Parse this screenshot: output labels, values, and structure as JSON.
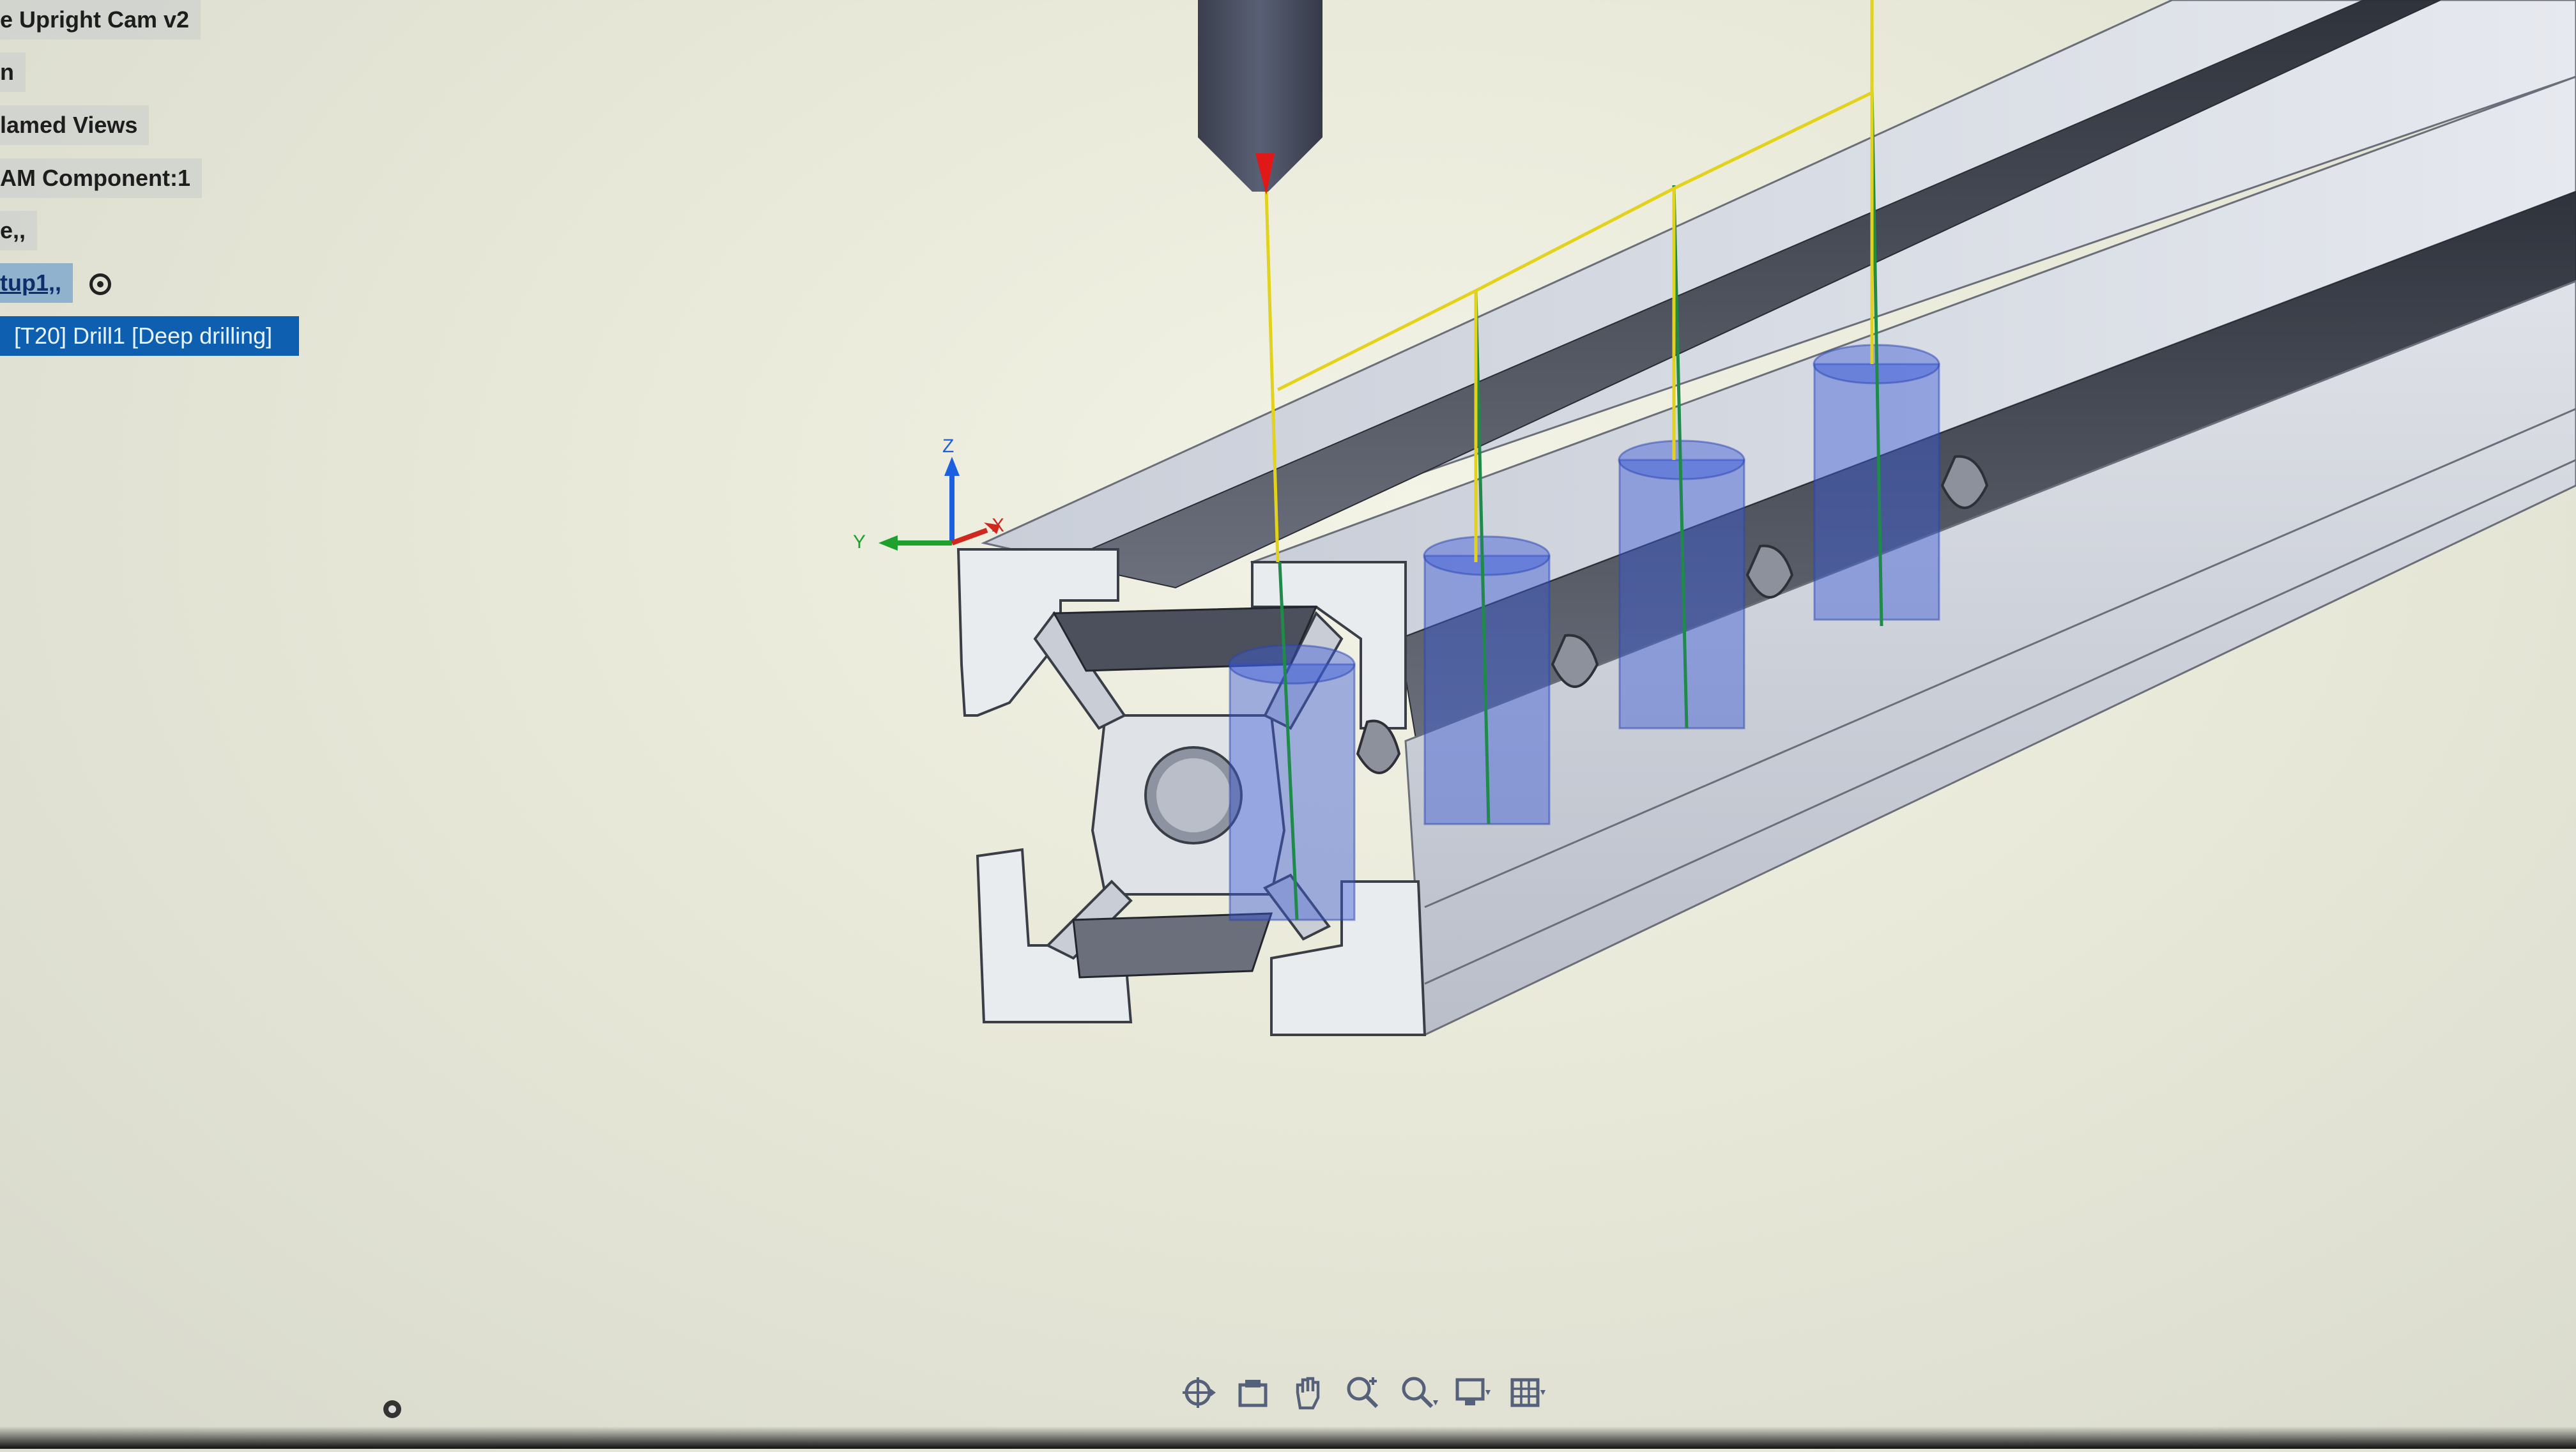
{
  "browser": {
    "items": [
      {
        "label": "e Upright Cam v2"
      },
      {
        "label": "n"
      },
      {
        "label": "lamed Views"
      },
      {
        "label": "AM Component:1"
      },
      {
        "label": "e,,"
      },
      {
        "label": "tup1,,"
      },
      {
        "label": "[T20] Drill1 [Deep drilling]"
      }
    ]
  },
  "axes": {
    "z": "Z",
    "y": "Y",
    "x": "X"
  },
  "colors": {
    "selection": "#0f5fb0",
    "hole_body": "#3b5bd6",
    "tool_body": "#4a4f63",
    "tool_tip": "#e01818",
    "toolpath": "#e2d21b",
    "drill_path": "#1f8a4a",
    "axis_z": "#1c5fe0",
    "axis_y": "#1ea02e",
    "axis_x": "#d0281e"
  },
  "toolbar": {
    "icons": [
      "orbit-icon",
      "look-at-icon",
      "pan-icon",
      "zoom-window-icon",
      "fit-icon",
      "display-settings-icon",
      "grid-settings-icon"
    ]
  }
}
